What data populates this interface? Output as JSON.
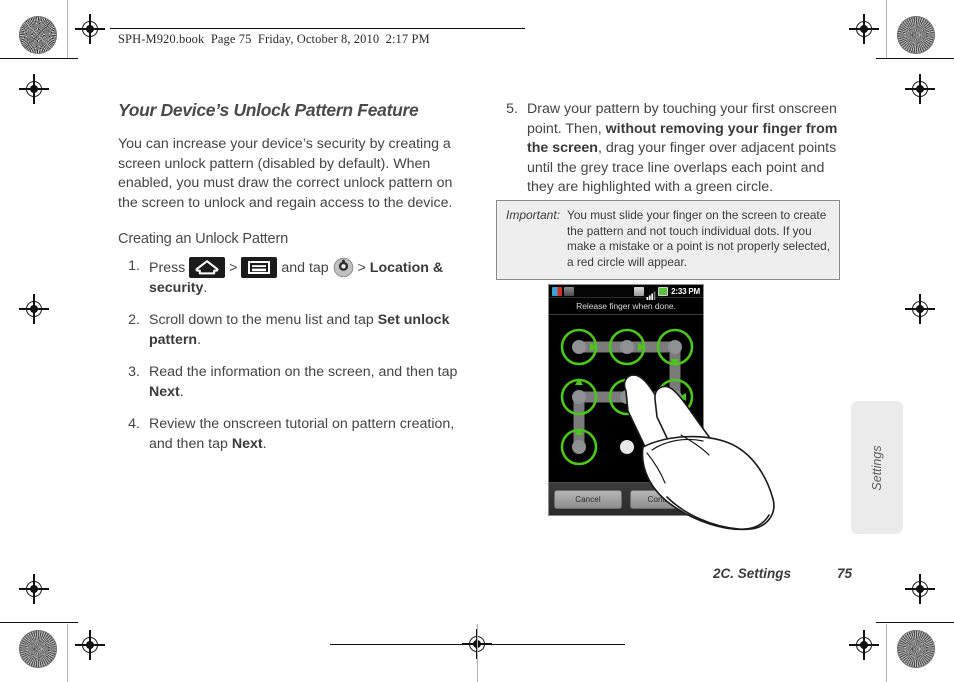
{
  "print_header": {
    "text": "SPH-M920.book  Page 75  Friday, October 8, 2010  2:17 PM"
  },
  "left_column": {
    "section_title": "Your Device’s Unlock Pattern Feature",
    "intro": "You can increase your device’s security by creating a screen unlock pattern (disabled by default). When enabled, you must draw the correct unlock pattern on the screen to unlock and regain access to the device.",
    "sub_title": "Creating an Unlock Pattern",
    "steps": [
      {
        "number": "1.",
        "pre": "Press ",
        "icon1": "home-icon",
        "mid1": " > ",
        "icon2": "menu-icon",
        "mid2": " and tap ",
        "icon3": "settings-gear-icon",
        "mid3": " > ",
        "bold": "Location & security",
        "post": "."
      },
      {
        "number": "2.",
        "pre": "Scroll down to the menu list and tap ",
        "bold": "Set unlock pattern",
        "post": "."
      },
      {
        "number": "3.",
        "pre": "Read the information on the screen, and then tap ",
        "bold": "Next",
        "post": "."
      },
      {
        "number": "4.",
        "pre": "Review the onscreen tutorial on pattern creation, and then tap ",
        "bold": "Next",
        "post": "."
      }
    ]
  },
  "right_column": {
    "steps": [
      {
        "number": "5.",
        "pre": "Draw your pattern by touching your first onscreen point. Then, ",
        "bold": "without removing your finger from the screen",
        "post": ", drag your finger over adjacent points until the grey trace line overlaps each point and they are highlighted with a green circle."
      }
    ]
  },
  "important_note": {
    "label": "Important:",
    "text": "You must slide your finger on the screen to create the pattern and not touch individual dots. If you make a mistake or a point is not properly selected, a red circle will appear."
  },
  "phone_screenshot": {
    "status_bar": {
      "clock": "2:33 PM",
      "left_icons": [
        "sim-alert-icon",
        "camera-icon"
      ],
      "right_icons": [
        "sync-icon",
        "signal-bars-icon",
        "battery-icon"
      ]
    },
    "prompt": "Release finger when done.",
    "buttons": {
      "cancel": "Cancel",
      "continue": "Continue"
    },
    "pattern": {
      "selected_nodes": [
        1,
        2,
        3,
        4,
        5,
        6,
        7
      ],
      "unselected_nodes": [
        8,
        9
      ],
      "node_arrows": {
        "1": "right",
        "2": "right",
        "3": "down",
        "6": "left",
        "4": "up",
        "7": "up"
      },
      "trace_segments": [
        [
          1,
          2
        ],
        [
          2,
          3
        ],
        [
          3,
          6
        ],
        [
          6,
          5
        ],
        [
          5,
          4
        ],
        [
          4,
          7
        ]
      ]
    },
    "colors": {
      "node_green": "#4cc617",
      "node_dot": "#8f9094",
      "trace_grey": "#7a7a7a",
      "screen_black": "#000000"
    }
  },
  "side_tab": {
    "label": "Settings"
  },
  "footer": {
    "chapter": "2C. Settings",
    "page_number": "75"
  }
}
